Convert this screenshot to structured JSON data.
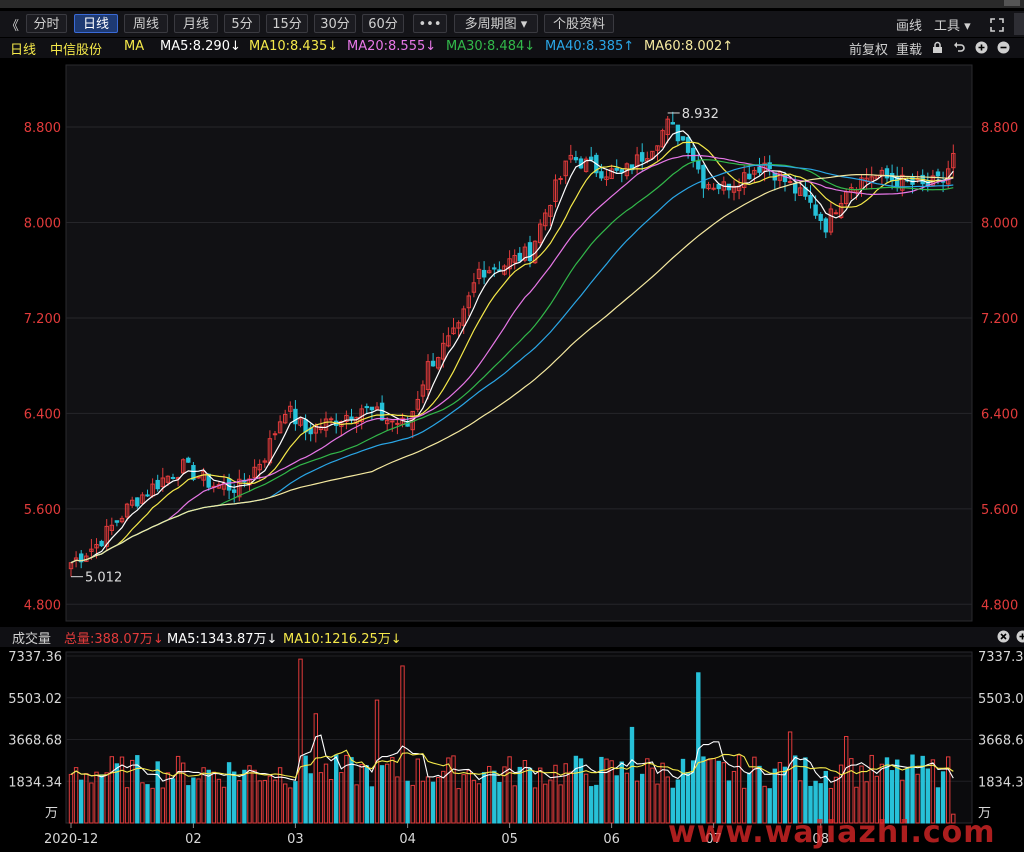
{
  "toolbar": {
    "collapse_label": "《",
    "buttons": [
      "分时",
      "日线",
      "周线",
      "月线",
      "5分",
      "15分",
      "30分",
      "60分",
      "•••",
      "多周期图 ▾",
      "个股资料"
    ],
    "active_index": 1,
    "draw_label": "画线",
    "tools_label": "工具 ▾"
  },
  "info": {
    "period": "日线",
    "stock": "中信股份",
    "ma_label": "MA",
    "ma": [
      {
        "text": "MA5:8.290↓",
        "color": "#ffffff"
      },
      {
        "text": "MA10:8.435↓",
        "color": "#f5e94a"
      },
      {
        "text": "MA20:8.555↓",
        "color": "#e777e7"
      },
      {
        "text": "MA30:8.484↓",
        "color": "#32b84a"
      },
      {
        "text": "MA40:8.385↑",
        "color": "#2aa6e6"
      },
      {
        "text": "MA60:8.002↑",
        "color": "#f5e9a0"
      }
    ],
    "adj_label": "前复权",
    "reload_label": "重载"
  },
  "volume_info": {
    "title": "成交量",
    "total": "总量:388.07万↓",
    "ma5": "MA5:1343.87万↓",
    "ma10": "MA10:1216.25万↓"
  },
  "watermark": "www.wajiazhi.com",
  "colors": {
    "up": "#e23b3b",
    "down": "#27c1d8",
    "ma5": "#ffffff",
    "ma10": "#f5e94a",
    "ma20": "#e777e7",
    "ma30": "#32b84a",
    "ma40": "#2aa6e6",
    "ma60": "#f5e9a0",
    "vol_ma5": "#ffffff",
    "vol_ma10": "#f5e94a",
    "axis_text": "#e23b3b"
  },
  "chart_data": [
    {
      "type": "candlestick",
      "title": "中信股份 日线",
      "y_ticks": [
        8.8,
        8.0,
        7.2,
        6.4,
        5.6,
        4.8
      ],
      "y_tick_labels": [
        "8.800",
        "8.000",
        "7.200",
        "6.400",
        "5.600",
        "4.800"
      ],
      "ylim": [
        4.66,
        9.32
      ],
      "price_anchors": [
        {
          "day": 0,
          "price": 5.15
        },
        {
          "day": 5,
          "price": 5.3
        },
        {
          "day": 12,
          "price": 5.65
        },
        {
          "day": 18,
          "price": 5.85
        },
        {
          "day": 22,
          "price": 5.95
        },
        {
          "day": 28,
          "price": 5.8
        },
        {
          "day": 33,
          "price": 5.78
        },
        {
          "day": 38,
          "price": 6.05
        },
        {
          "day": 42,
          "price": 6.45
        },
        {
          "day": 46,
          "price": 6.25
        },
        {
          "day": 52,
          "price": 6.35
        },
        {
          "day": 57,
          "price": 6.45
        },
        {
          "day": 62,
          "price": 6.35
        },
        {
          "day": 66,
          "price": 6.3
        },
        {
          "day": 70,
          "price": 6.8
        },
        {
          "day": 76,
          "price": 7.1
        },
        {
          "day": 80,
          "price": 7.6
        },
        {
          "day": 85,
          "price": 7.65
        },
        {
          "day": 90,
          "price": 7.75
        },
        {
          "day": 94,
          "price": 8.2
        },
        {
          "day": 98,
          "price": 8.55
        },
        {
          "day": 103,
          "price": 8.45
        },
        {
          "day": 108,
          "price": 8.4
        },
        {
          "day": 113,
          "price": 8.6
        },
        {
          "day": 117,
          "price": 8.82
        },
        {
          "day": 121,
          "price": 8.65
        },
        {
          "day": 124,
          "price": 8.35
        },
        {
          "day": 128,
          "price": 8.3
        },
        {
          "day": 132,
          "price": 8.4
        },
        {
          "day": 136,
          "price": 8.5
        },
        {
          "day": 140,
          "price": 8.35
        },
        {
          "day": 145,
          "price": 8.15
        },
        {
          "day": 148,
          "price": 7.98
        },
        {
          "day": 152,
          "price": 8.3
        },
        {
          "day": 157,
          "price": 8.4
        },
        {
          "day": 162,
          "price": 8.35
        },
        {
          "day": 167,
          "price": 8.3
        },
        {
          "day": 171,
          "price": 8.35
        },
        {
          "day": 173,
          "price": 8.55
        }
      ],
      "annotations": [
        {
          "text": "8.932",
          "day": 117
        },
        {
          "text": "5.012",
          "day": 0
        }
      ],
      "series": [
        "MA5",
        "MA10",
        "MA20",
        "MA30",
        "MA40",
        "MA60"
      ]
    },
    {
      "type": "bar",
      "title": "成交量",
      "y_ticks": [
        7337.36,
        5503.02,
        3668.68,
        1834.34
      ],
      "y_tick_labels": [
        "7337.36",
        "5503.02",
        "3668.68",
        "1834.34"
      ],
      "y_unit": "万",
      "ylim": [
        0,
        7337.36
      ],
      "x_tick_labels": [
        {
          "label": "2020-12",
          "day": 0
        },
        {
          "label": "02",
          "day": 24
        },
        {
          "label": "03",
          "day": 44
        },
        {
          "label": "04",
          "day": 66
        },
        {
          "label": "05",
          "day": 86
        },
        {
          "label": "06",
          "day": 106
        },
        {
          "label": "07",
          "day": 126
        },
        {
          "label": "08",
          "day": 147
        }
      ],
      "spikes": [
        {
          "day": 45,
          "value": 7200
        },
        {
          "day": 48,
          "value": 4800
        },
        {
          "day": 60,
          "value": 5400
        },
        {
          "day": 65,
          "value": 6900
        },
        {
          "day": 110,
          "value": 4200
        },
        {
          "day": 123,
          "value": 6600
        },
        {
          "day": 141,
          "value": 4000
        },
        {
          "day": 152,
          "value": 3800
        },
        {
          "day": 171,
          "value": 2250
        }
      ],
      "last_value": 388.07,
      "series": [
        "VOL",
        "MA5",
        "MA10"
      ]
    }
  ]
}
